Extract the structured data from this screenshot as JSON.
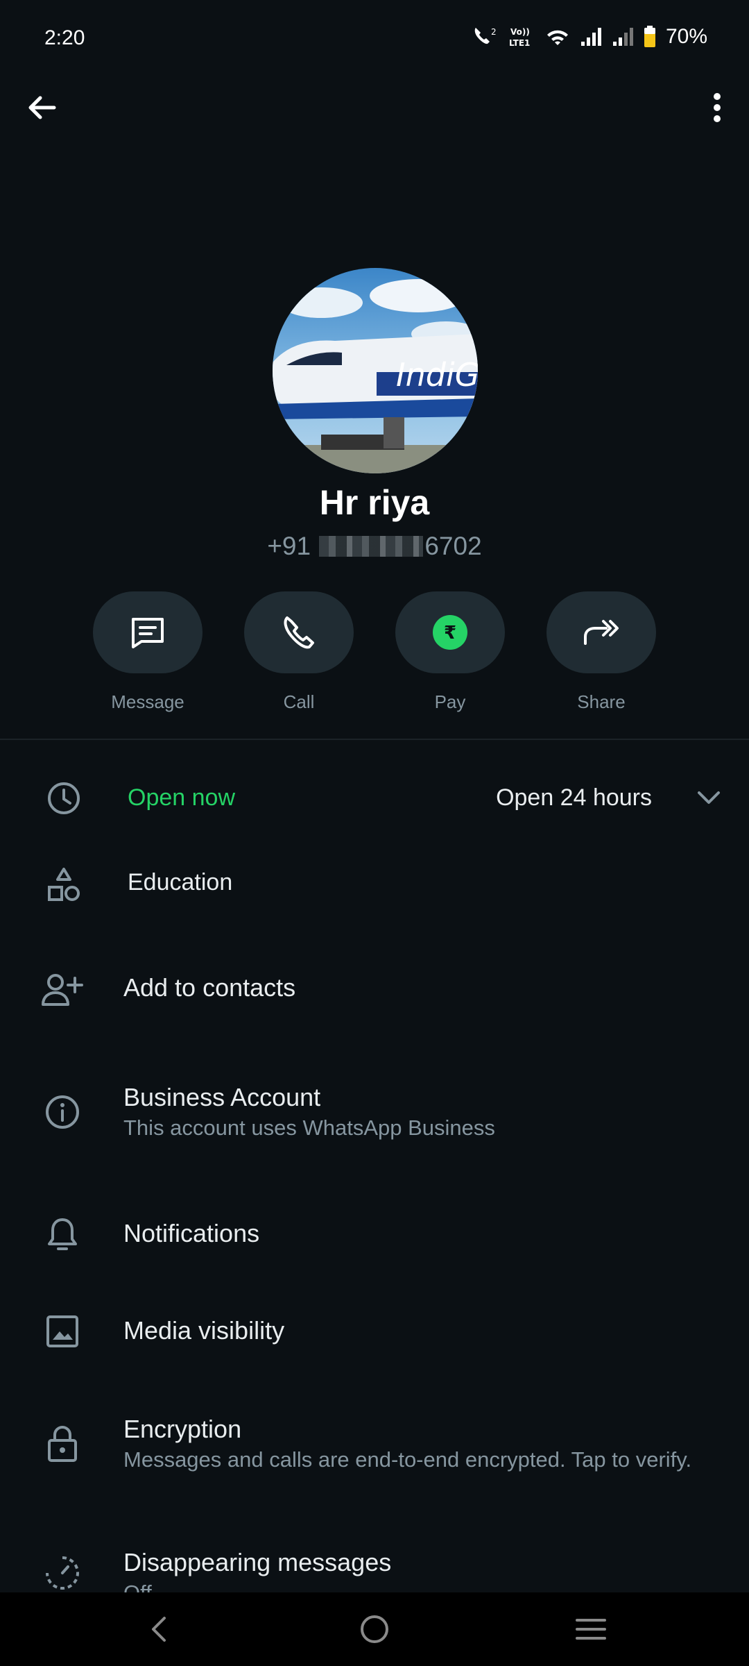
{
  "status_bar": {
    "time": "2:20",
    "battery": "70%"
  },
  "header": {
    "back_icon": "arrow-left-icon",
    "menu_icon": "more-vertical-icon"
  },
  "contact": {
    "name": "Hr riya",
    "phone_prefix": "+91",
    "phone_suffix": "6702",
    "avatar_text": "IndiGo"
  },
  "actions": [
    {
      "label": "Message",
      "icon": "message-icon"
    },
    {
      "label": "Call",
      "icon": "phone-icon"
    },
    {
      "label": "Pay",
      "icon": "rupee-icon"
    },
    {
      "label": "Share",
      "icon": "share-icon"
    }
  ],
  "business_hours": {
    "status": "Open now",
    "hours": "Open 24 hours"
  },
  "category": "Education",
  "list": {
    "add_contacts": "Add to contacts",
    "business_account_title": "Business Account",
    "business_account_sub": "This account uses WhatsApp Business",
    "notifications": "Notifications",
    "media_visibility": "Media visibility",
    "encryption_title": "Encryption",
    "encryption_sub": "Messages and calls are end-to-end encrypted. Tap to verify.",
    "disappearing_title": "Disappearing messages",
    "disappearing_sub": "Off"
  },
  "colors": {
    "background": "#0b1014",
    "accent_green": "#25d366",
    "secondary_text": "#8696a0",
    "button_bg": "#202c33"
  }
}
